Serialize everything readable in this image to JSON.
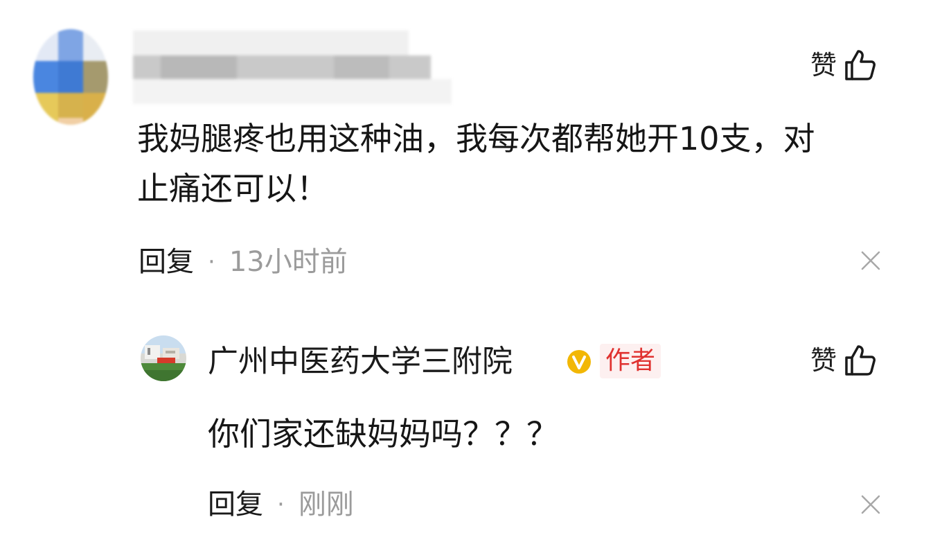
{
  "comment": {
    "like_label": "赞",
    "text_line1": "我妈腿疼也用这种油，我每次都帮她开10支，对",
    "text_line2": "止痛还可以！",
    "reply_label": "回复",
    "separator": "·",
    "timestamp": "13小时前"
  },
  "reply": {
    "author_name": "广州中医药大学三附院",
    "verified_badge": "V",
    "author_tag": "作者",
    "like_label": "赞",
    "text": "你们家还缺妈妈吗？？？",
    "reply_label": "回复",
    "separator": "·",
    "timestamp": "刚刚"
  },
  "colors": {
    "text": "#1a1a1a",
    "muted": "#9b9b9b",
    "author_tag_text": "#e0312f",
    "author_tag_bg": "#fdf0f0",
    "verified": "#f2b705"
  }
}
